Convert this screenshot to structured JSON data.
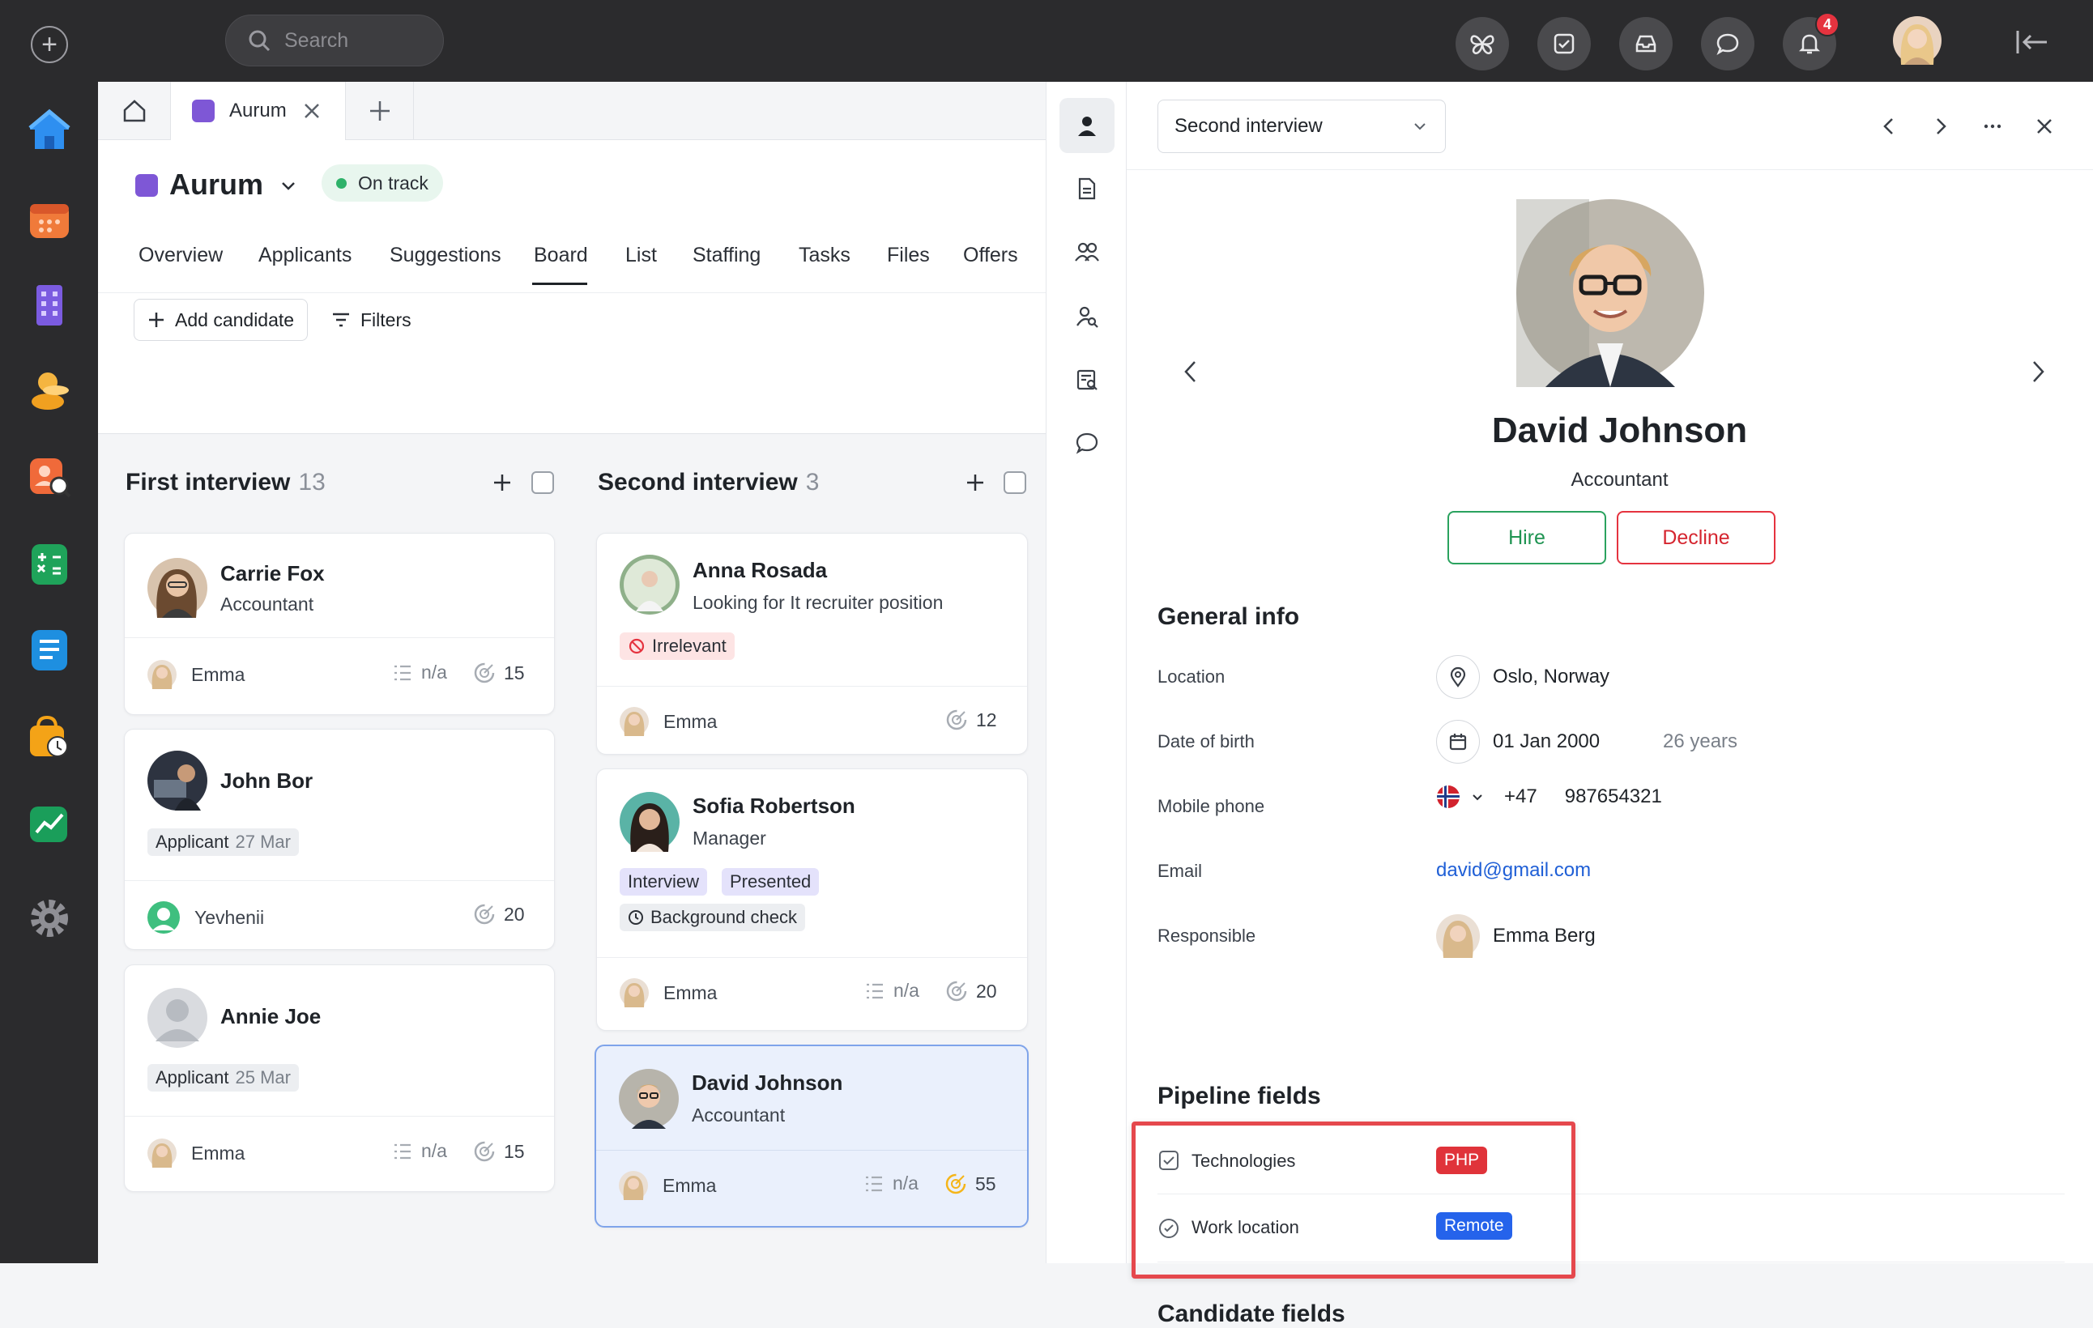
{
  "topbar": {
    "search_placeholder": "Search",
    "notifications_count": "4"
  },
  "apps": [
    "home",
    "calendar",
    "company",
    "people",
    "recruiting",
    "sheets",
    "docs",
    "store",
    "analytics",
    "settings"
  ],
  "tabs": {
    "active_tab_label": "Aurum",
    "accent": "#7e57d6"
  },
  "project": {
    "name": "Aurum",
    "status": "On track",
    "status_color": "#2fb26a",
    "nav": [
      "Overview",
      "Applicants",
      "Suggestions",
      "Board",
      "List",
      "Staffing",
      "Tasks",
      "Files",
      "Offers"
    ],
    "active_nav": "Board",
    "add_candidate": "Add candidate",
    "filters": "Filters"
  },
  "columns": [
    {
      "title": "First interview",
      "count": "13",
      "cards": [
        {
          "name": "Carrie Fox",
          "role": "Accountant",
          "owner": "Emma",
          "checklist": "n/a",
          "score": "15"
        },
        {
          "name": "John Bor",
          "tag": "Applicant",
          "tag_date": "27 Mar",
          "owner": "Yevhenii",
          "score": "20"
        },
        {
          "name": "Annie Joe",
          "tag": "Applicant",
          "tag_date": "25 Mar",
          "owner": "Emma",
          "checklist": "n/a",
          "score": "15"
        }
      ]
    },
    {
      "title": "Second interview",
      "count": "3",
      "cards": [
        {
          "name": "Anna Rosada",
          "role": "Looking for It recruiter position",
          "tags": [
            "Irrelevant"
          ],
          "owner": "Emma",
          "score": "12"
        },
        {
          "name": "Sofia Robertson",
          "role": "Manager",
          "tags": [
            "Interview",
            "Presented",
            "Background check"
          ],
          "owner": "Emma",
          "checklist": "n/a",
          "score": "20"
        },
        {
          "name": "David Johnson",
          "role": "Accountant",
          "owner": "Emma",
          "checklist": "n/a",
          "score": "55"
        }
      ]
    }
  ],
  "panel": {
    "stage": "Second interview",
    "candidate_name": "David Johnson",
    "candidate_role": "Accountant",
    "hire": "Hire",
    "decline": "Decline",
    "general_info_title": "General info",
    "fields": {
      "location_label": "Location",
      "location_value": "Oslo, Norway",
      "dob_label": "Date of birth",
      "dob_value": "01 Jan 2000",
      "age": "26 years",
      "phone_label": "Mobile phone",
      "phone_code": "+47",
      "phone_number": "987654321",
      "email_label": "Email",
      "email_value": "david@gmail.com",
      "responsible_label": "Responsible",
      "responsible_value": "Emma Berg"
    },
    "pipeline_title": "Pipeline fields",
    "pipeline": {
      "tech_label": "Technologies",
      "tech_value": "PHP",
      "tech_color": "#e0333a",
      "work_label": "Work location",
      "work_value": "Remote",
      "work_color": "#2563eb"
    },
    "candidate_fields_title": "Candidate fields"
  }
}
